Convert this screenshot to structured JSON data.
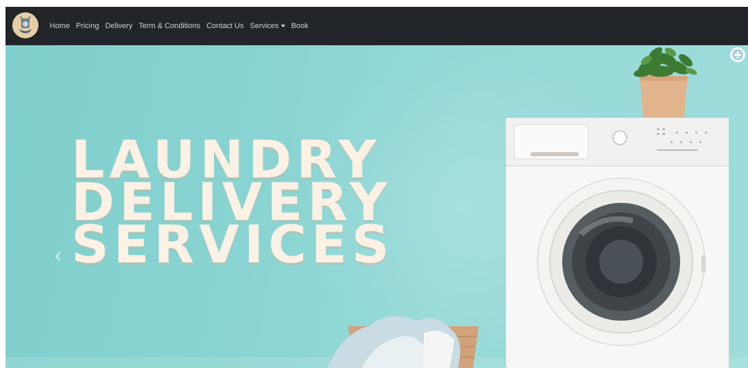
{
  "navbar": {
    "logo_icon": "laundry-logo-icon",
    "links": [
      {
        "label": "Home"
      },
      {
        "label": "Pricing"
      },
      {
        "label": "Delivery"
      },
      {
        "label": "Term & Conditions"
      },
      {
        "label": "Contact Us"
      },
      {
        "label": "Services",
        "dropdown": true
      },
      {
        "label": "Book"
      }
    ],
    "background": "#212529"
  },
  "hero": {
    "headline": [
      "LAUNDRY",
      "DELIVERY",
      "SERVICES"
    ],
    "prev_icon": "chevron-left-icon",
    "prev_glyph": "‹",
    "zoom_icon": "expand-icon",
    "background": "#8ed6d4",
    "headline_color": "#fbf1e4"
  }
}
